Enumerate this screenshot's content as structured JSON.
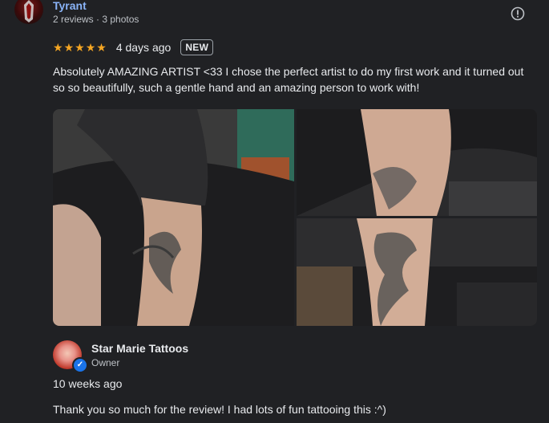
{
  "reviewer": {
    "name": "Tyrant",
    "meta": "2 reviews · 3 photos"
  },
  "review": {
    "stars": [
      "★",
      "★",
      "★",
      "★",
      "★"
    ],
    "rating": 5,
    "date": "4 days ago",
    "badge": "NEW",
    "text": "Absolutely AMAZING ARTIST <33 I chose the perfect artist to do my first work and it turned out so so beautifully, such a gentle hand and an amazing person to work with!"
  },
  "photos": [
    {
      "icon": "forearm-tattoo-photo"
    },
    {
      "icon": "forearm-tattoo-photo"
    },
    {
      "icon": "forearm-tattoo-photo"
    }
  ],
  "owner": {
    "name": "Star Marie Tattoos",
    "role": "Owner",
    "verified_icon": "check-icon"
  },
  "reply": {
    "date": "10 weeks ago",
    "text": "Thank you so much for the review! I had lots of fun tattooing this :^)"
  },
  "colors": {
    "background": "#202124",
    "link": "#8ab4f8",
    "star": "#f5a623",
    "verified": "#1a73e8"
  }
}
